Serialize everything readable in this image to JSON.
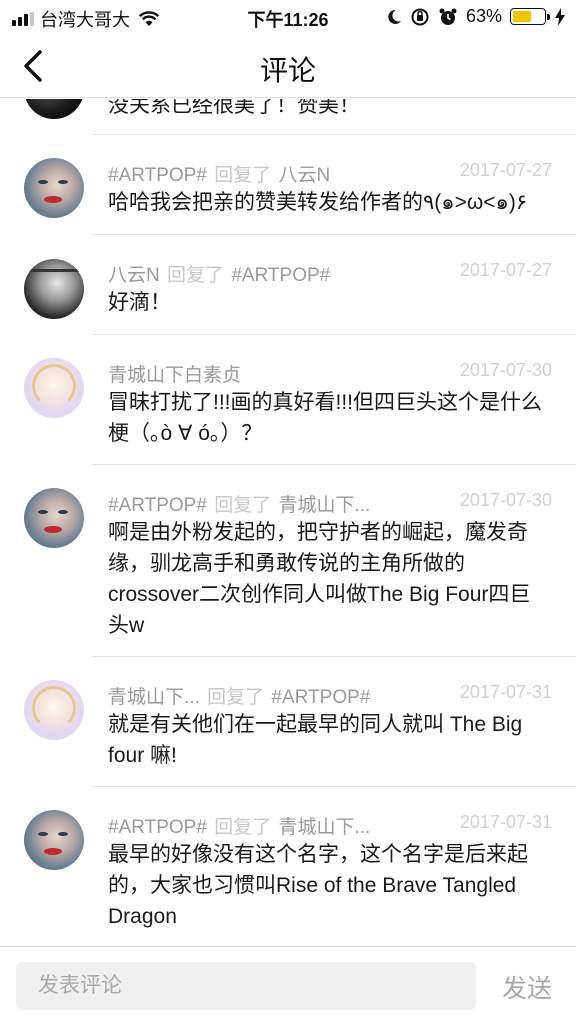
{
  "status_bar": {
    "carrier": "台湾大哥大",
    "time": "下午11:26",
    "battery_percent": "63%",
    "battery_level": 0.63,
    "battery_color": "#f5c400"
  },
  "nav": {
    "title": "评论",
    "back_icon": "chevron-left-icon"
  },
  "comments": [
    {
      "username": "",
      "replied_label": "",
      "reply_to": "",
      "date": "",
      "text": "没关系已经很美了！赞美！",
      "avatar": "dark-avatar"
    },
    {
      "username": "#ARTPOP#",
      "replied_label": "回复了",
      "reply_to": "八云N",
      "date": "2017-07-27",
      "text": "哈哈我会把亲的赞美转发给作者的٩(๑>ω<๑)۶",
      "avatar": "artpop-avatar"
    },
    {
      "username": "八云N",
      "replied_label": "回复了",
      "reply_to": "#ARTPOP#",
      "date": "2017-07-27",
      "text": "好滴！",
      "avatar": "bw-avatar"
    },
    {
      "username": "青城山下白素贞",
      "replied_label": "",
      "reply_to": "",
      "date": "2017-07-30",
      "text": "冒昧打扰了!!!画的真好看!!!但四巨头这个是什么梗（｡ò ∀ ó｡）？",
      "avatar": "pastel-avatar"
    },
    {
      "username": "#ARTPOP#",
      "replied_label": "回复了",
      "reply_to": "青城山下...",
      "date": "2017-07-30",
      "text": "啊是由外粉发起的，把守护者的崛起，魔发奇缘，驯龙高手和勇敢传说的主角所做的crossover二次创作同人叫做The Big Four四巨头w",
      "avatar": "artpop-avatar"
    },
    {
      "username": "青城山下...",
      "replied_label": "回复了",
      "reply_to": "#ARTPOP#",
      "date": "2017-07-31",
      "text": "就是有关他们在一起最早的同人就叫 The Big four 嘛!",
      "avatar": "pastel-avatar"
    },
    {
      "username": "#ARTPOP#",
      "replied_label": "回复了",
      "reply_to": "青城山下...",
      "date": "2017-07-31",
      "text": "最早的好像没有这个名字，这个名字是后来起的，大家也习惯叫Rise of the Brave Tangled Dragon",
      "avatar": "artpop-avatar"
    }
  ],
  "input_bar": {
    "placeholder": "发表评论",
    "send_label": "发送"
  }
}
